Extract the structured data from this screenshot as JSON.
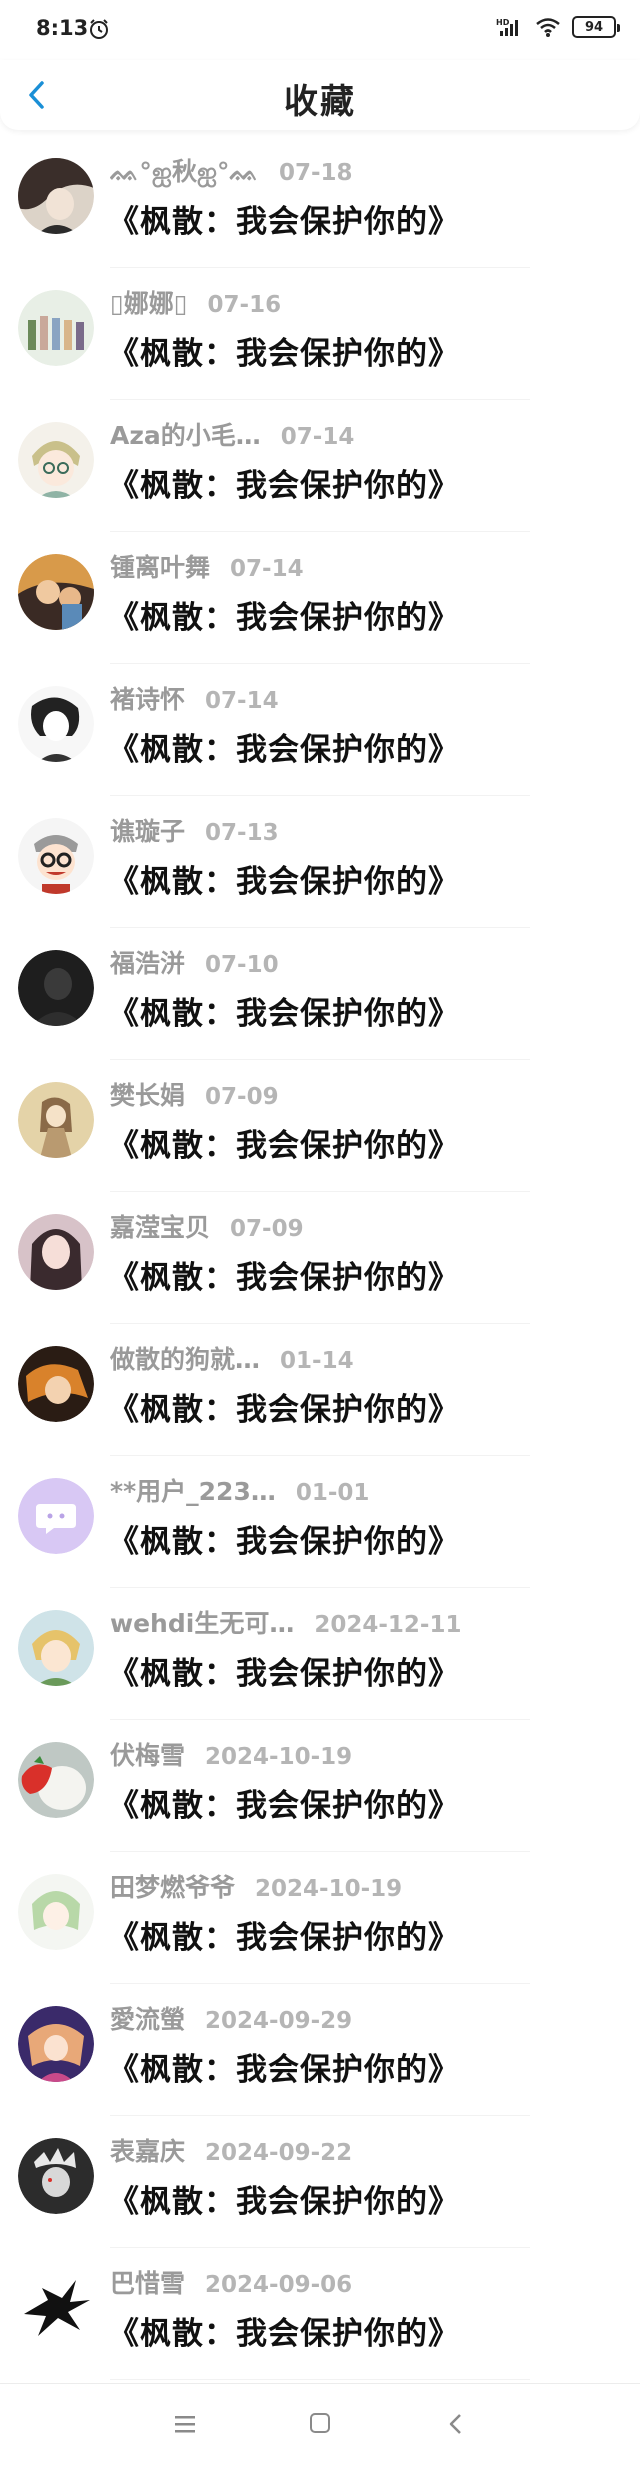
{
  "status_bar": {
    "time": "8:13",
    "network_label": "HD",
    "battery": "94"
  },
  "header": {
    "title": "收藏",
    "back_icon": "chevron-left-icon"
  },
  "items": [
    {
      "user": "ᨐ°ஐ秋ஐ°ᨐ",
      "date": "07-18",
      "title": "《枫散：我会保护你的》"
    },
    {
      "user": "▯娜娜▯",
      "date": "07-16",
      "title": "《枫散：我会保护你的》"
    },
    {
      "user": "Aza的小毛…",
      "date": "07-14",
      "title": "《枫散：我会保护你的》"
    },
    {
      "user": "锺离叶舞",
      "date": "07-14",
      "title": "《枫散：我会保护你的》"
    },
    {
      "user": "褚诗怀",
      "date": "07-14",
      "title": "《枫散：我会保护你的》"
    },
    {
      "user": "谯璇子",
      "date": "07-13",
      "title": "《枫散：我会保护你的》"
    },
    {
      "user": "福浩洴",
      "date": "07-10",
      "title": "《枫散：我会保护你的》"
    },
    {
      "user": "樊长娟",
      "date": "07-09",
      "title": "《枫散：我会保护你的》"
    },
    {
      "user": "嘉滢宝贝",
      "date": "07-09",
      "title": "《枫散：我会保护你的》"
    },
    {
      "user": "做散的狗就…",
      "date": "01-14",
      "title": "《枫散：我会保护你的》"
    },
    {
      "user": "**用户_223…",
      "date": "01-01",
      "title": "《枫散：我会保护你的》"
    },
    {
      "user": "wehdi生无可…",
      "date": "2024-12-11",
      "title": "《枫散：我会保护你的》"
    },
    {
      "user": "伏梅雪",
      "date": "2024-10-19",
      "title": "《枫散：我会保护你的》"
    },
    {
      "user": "田梦燃爷爷",
      "date": "2024-10-19",
      "title": "《枫散：我会保护你的》"
    },
    {
      "user": "愛流螢",
      "date": "2024-09-29",
      "title": "《枫散：我会保护你的》"
    },
    {
      "user": "表嘉庆",
      "date": "2024-09-22",
      "title": "《枫散：我会保护你的》"
    },
    {
      "user": "巴惜雪",
      "date": "2024-09-06",
      "title": "《枫散：我会保护你的》"
    }
  ],
  "colors": {
    "accent": "#1a8fd6",
    "name_gray": "#9a9a9a",
    "date_gray": "#b5b5b5"
  },
  "nav_bar": {
    "menu_icon": "menu-icon",
    "home_icon": "home-square-icon",
    "back_icon": "back-triangle-icon"
  }
}
